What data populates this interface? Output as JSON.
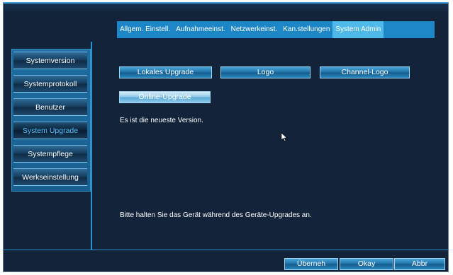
{
  "tabs": [
    {
      "label": "Allgem. Einstell."
    },
    {
      "label": "Aufnahmeeinst."
    },
    {
      "label": "Netzwerkeinst."
    },
    {
      "label": "Kan.stellungen"
    },
    {
      "label": "System Admin"
    }
  ],
  "sidebar": {
    "items": [
      {
        "label": "Systemversion"
      },
      {
        "label": "Systemprotokoll"
      },
      {
        "label": "Benutzer"
      },
      {
        "label": "System Upgrade"
      },
      {
        "label": "Systempflege"
      },
      {
        "label": "Werkseinstellung"
      }
    ]
  },
  "main": {
    "buttons": {
      "local_upgrade": "Lokales Upgrade",
      "logo": "Logo",
      "channel_logo": "Channel-Logo",
      "online_upgrade": "Online-Upgrade"
    },
    "status_text": "Es ist die neueste Version.",
    "note_text": "Bitte halten Sie das Gerät während des Geräte-Upgrades an."
  },
  "footer": {
    "apply_label": "Überneh",
    "ok_label": "Okay",
    "cancel_label": "Abbr"
  },
  "colors": {
    "background": "#12233a",
    "tab_bar": "#1d86c6",
    "tab_active": "#4fb9ea",
    "sidebar_active_text": "#4fc3ff",
    "accent_line": "#2a94cf"
  }
}
